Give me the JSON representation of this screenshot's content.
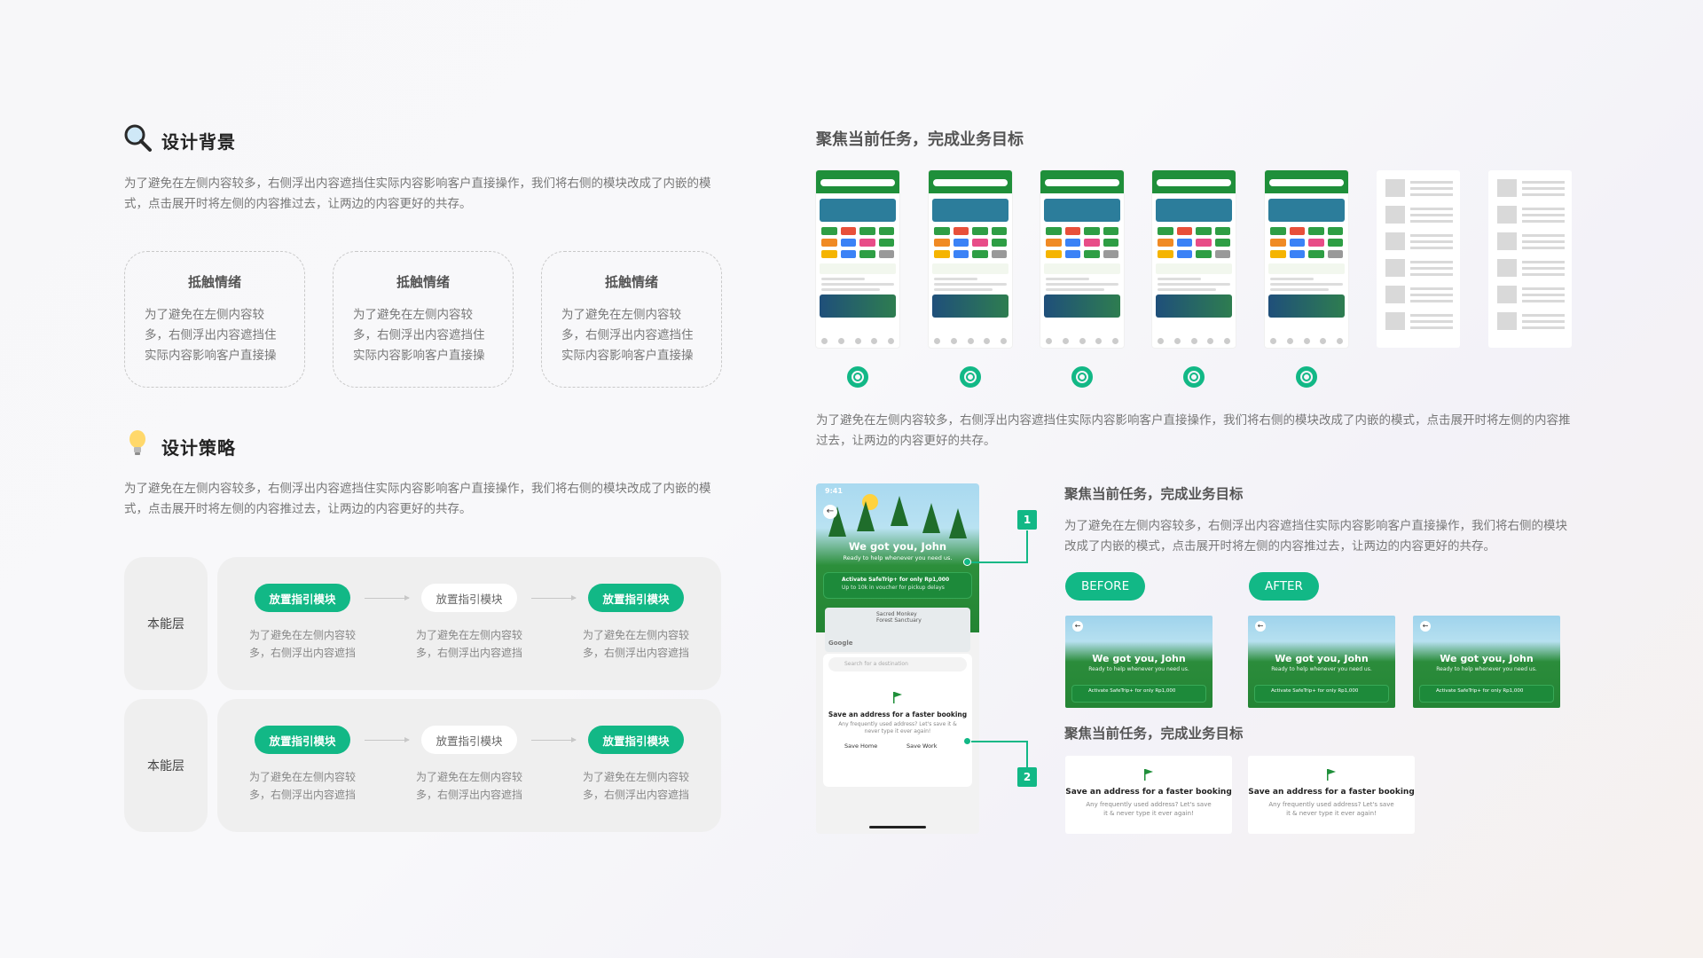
{
  "left": {
    "background": {
      "title": "设计背景",
      "icon": "magnifier-icon",
      "paragraph": "为了避免在左侧内容较多，右侧浮出内容遮挡住实际内容影响客户直接操作，我们将右侧的模块改成了内嵌的模式，点击展开时将左侧的内容推过去，让两边的内容更好的共存。",
      "pain_cards": [
        {
          "title": "抵触情绪",
          "desc": "为了避免在左侧内容较多，右侧浮出内容遮挡住实际内容影响客户直接操"
        },
        {
          "title": "抵触情绪",
          "desc": "为了避免在左侧内容较多，右侧浮出内容遮挡住实际内容影响客户直接操"
        },
        {
          "title": "抵触情绪",
          "desc": "为了避免在左侧内容较多，右侧浮出内容遮挡住实际内容影响客户直接操"
        }
      ]
    },
    "strategy": {
      "title": "设计策略",
      "icon": "lightbulb-icon",
      "paragraph": "为了避免在左侧内容较多，右侧浮出内容遮挡住实际内容影响客户直接操作，我们将右侧的模块改成了内嵌的模式，点击展开时将左侧的内容推过去，让两边的内容更好的共存。",
      "layers": [
        {
          "label": "本能层",
          "steps": [
            {
              "pill": "放置指引模块",
              "desc": "为了避免在左侧内容较多，右侧浮出内容遮挡"
            },
            {
              "pill": "放置指引模块",
              "desc": "为了避免在左侧内容较多，右侧浮出内容遮挡"
            },
            {
              "pill": "放置指引模块",
              "desc": "为了避免在左侧内容较多，右侧浮出内容遮挡"
            }
          ]
        },
        {
          "label": "本能层",
          "steps": [
            {
              "pill": "放置指引模块",
              "desc": "为了避免在左侧内容较多，右侧浮出内容遮挡"
            },
            {
              "pill": "放置指引模块",
              "desc": "为了避免在左侧内容较多，右侧浮出内容遮挡"
            },
            {
              "pill": "放置指引模块",
              "desc": "为了避免在左侧内容较多，右侧浮出内容遮挡"
            }
          ]
        }
      ]
    }
  },
  "right": {
    "top_title": "聚焦当前任务，完成业务目标",
    "top_paragraph": "为了避免在左侧内容较多，右侧浮出内容遮挡住实际内容影响客户直接操作，我们将右侧的模块改成了内嵌的模式，点击展开时将左侧的内容推过去，让两边的内容更好的共存。",
    "phone_icon": "gojek-logo-icon",
    "big_phone": {
      "time": "9:41",
      "title": "We got you, John",
      "subtitle": "Ready to help whenever you need us.",
      "safe_trip": "Activate SafeTrip+ for only Rp1,000",
      "safe_trip_sub": "Up to 10k in voucher for pickup delays",
      "map_label": "Sacred Monkey Forest Sanctuary",
      "map_brand": "Google",
      "search_placeholder": "Search for a destination",
      "save_title": "Save an address for a faster booking",
      "save_desc": "Any frequently used address? Let's save it & never type it ever again!",
      "save_home": "Save Home",
      "save_work": "Save Work",
      "callouts": [
        "1",
        "2"
      ]
    },
    "detail": {
      "title1": "聚焦当前任务，完成业务目标",
      "paragraph": "为了避免在左侧内容较多，右侧浮出内容遮挡住实际内容影响客户直接操作，我们将右侧的模块改成了内嵌的模式，点击展开时将左侧的内容推过去，让两边的内容更好的共存。",
      "before": "BEFORE",
      "after": "AFTER",
      "mini_title": "We got you, John",
      "mini_sub": "Ready to help whenever you need us.",
      "mini_bar": "Activate SafeTrip+ for only Rp1,000",
      "title2": "聚焦当前任务，完成业务目标",
      "save_title": "Save an address for a faster booking",
      "save_desc": "Any frequently used address? Let's save it & never type it ever again!"
    }
  },
  "colors": {
    "accent": "#12b886",
    "phone_green": "#1f8f3a"
  }
}
